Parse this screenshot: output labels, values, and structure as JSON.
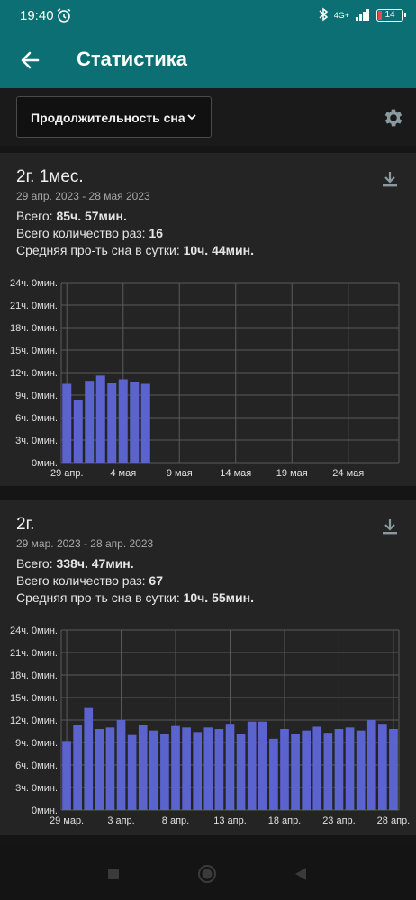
{
  "status": {
    "time": "19:40",
    "network": "4G+",
    "battery": "14"
  },
  "appbar": {
    "title": "Статистика"
  },
  "filter": {
    "selected": "Продолжительность сна"
  },
  "cards": [
    {
      "period": "2г. 1мес.",
      "range": "29 апр. 2023 - 28 мая 2023",
      "total_label": "Всего: ",
      "total_value": "85ч. 57мин.",
      "count_label": "Всего количество раз: ",
      "count_value": "16",
      "avg_label": "Средняя про-ть сна в сутки: ",
      "avg_value": "10ч. 44мин."
    },
    {
      "period": "2г.",
      "range": "29 мар. 2023 - 28 апр. 2023",
      "total_label": "Всего: ",
      "total_value": "338ч. 47мин.",
      "count_label": "Всего количество раз: ",
      "count_value": "67",
      "avg_label": "Средняя про-ть сна в сутки: ",
      "avg_value": "10ч. 55мин."
    }
  ],
  "colors": {
    "accent": "#0b6f73",
    "bar": "#5b63cf",
    "grid": "#5a5a5a",
    "card": "#242424"
  },
  "chart_data": [
    {
      "type": "bar",
      "ylabel_ticks": [
        "0мин.",
        "3ч. 0мин.",
        "6ч. 0мин.",
        "9ч. 0мин.",
        "12ч. 0мин.",
        "15ч. 0мин.",
        "18ч. 0мин.",
        "21ч. 0мин.",
        "24ч. 0мин."
      ],
      "ylim_hours": [
        0,
        24
      ],
      "x_ticks": [
        "29 апр.",
        "4 мая",
        "9 мая",
        "14 мая",
        "19 мая",
        "24 мая"
      ],
      "x_days": 30,
      "values_hours": [
        10.5,
        8.4,
        10.9,
        11.6,
        10.6,
        11.1,
        10.8,
        10.5
      ]
    },
    {
      "type": "bar",
      "ylabel_ticks": [
        "0мин.",
        "3ч. 0мин.",
        "6ч. 0мин.",
        "9ч. 0мин.",
        "12ч. 0мин.",
        "15ч. 0мин.",
        "18ч. 0мин.",
        "21ч. 0мин.",
        "24ч. 0мин."
      ],
      "ylim_hours": [
        0,
        24
      ],
      "x_ticks": [
        "29 мар.",
        "3 апр.",
        "8 апр.",
        "13 апр.",
        "18 апр.",
        "23 апр.",
        "28 апр."
      ],
      "x_days": 31,
      "values_hours": [
        9.2,
        11.4,
        13.6,
        10.8,
        11.0,
        12.0,
        10.0,
        11.4,
        10.6,
        10.2,
        11.2,
        11.0,
        10.4,
        11.0,
        10.8,
        11.5,
        10.2,
        11.8,
        11.8,
        9.5,
        10.8,
        10.2,
        10.6,
        11.1,
        10.3,
        10.8,
        11.0,
        10.6,
        12.0,
        11.5,
        10.8
      ]
    }
  ]
}
